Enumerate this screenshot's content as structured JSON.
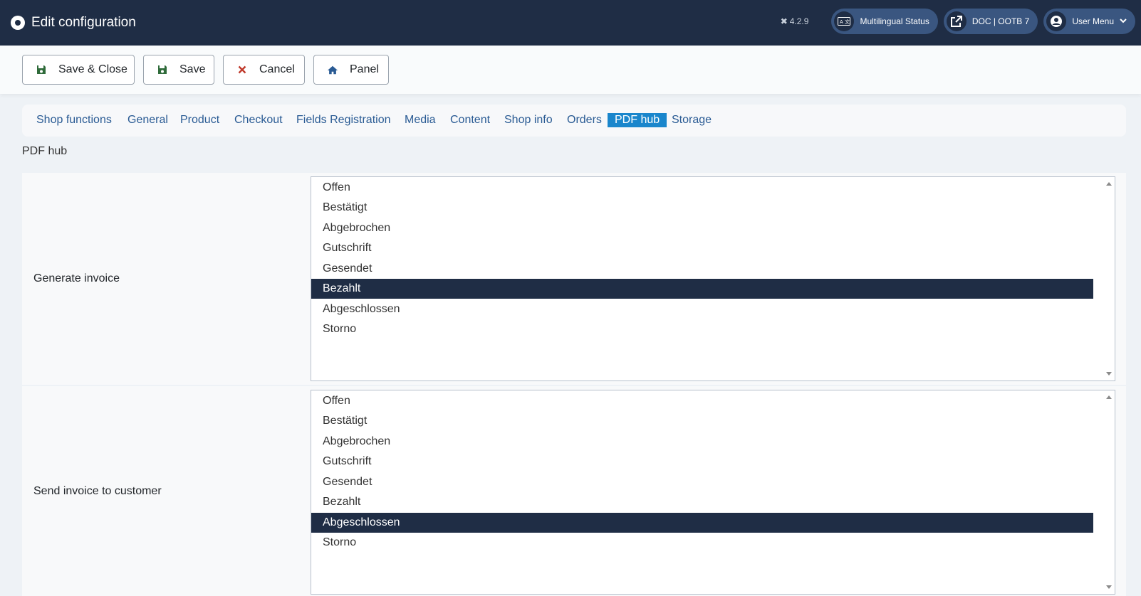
{
  "header": {
    "title": "Edit configuration",
    "version": "4.2.9",
    "multilingual_label": "Multilingual Status",
    "doc_label": "DOC | OOTB 7",
    "user_menu_label": "User Menu"
  },
  "toolbar": {
    "save_close_label": "Save & Close",
    "save_label": "Save",
    "cancel_label": "Cancel",
    "panel_label": "Panel"
  },
  "tabs": [
    {
      "label": "Shop functions"
    },
    {
      "label": "General"
    },
    {
      "label": "Product"
    },
    {
      "label": "Checkout"
    },
    {
      "label": "Fields Registration"
    },
    {
      "label": "Media"
    },
    {
      "label": "Content"
    },
    {
      "label": "Shop info"
    },
    {
      "label": "Orders"
    },
    {
      "label": "PDF hub"
    },
    {
      "label": "Storage"
    }
  ],
  "active_tab": "PDF hub",
  "section_title": "PDF hub",
  "fields": [
    {
      "label": "Generate invoice",
      "options": [
        "Offen",
        "Bestätigt",
        "Abgebrochen",
        "Gutschrift",
        "Gesendet",
        "Bezahlt",
        "Abgeschlossen",
        "Storno"
      ],
      "selected": "Bezahlt"
    },
    {
      "label": "Send invoice to customer",
      "options": [
        "Offen",
        "Bestätigt",
        "Abgebrochen",
        "Gutschrift",
        "Gesendet",
        "Bezahlt",
        "Abgeschlossen",
        "Storno"
      ],
      "selected": "Abgeschlossen"
    }
  ],
  "colors": {
    "header_bg": "#1f2d45",
    "pill_bg": "#3a5680",
    "active_tab_bg": "#1a86cc",
    "selected_option_bg": "#1f2d45",
    "save_icon": "#2f6b3a",
    "cancel_icon": "#c0392b",
    "panel_icon": "#2a5b94"
  }
}
